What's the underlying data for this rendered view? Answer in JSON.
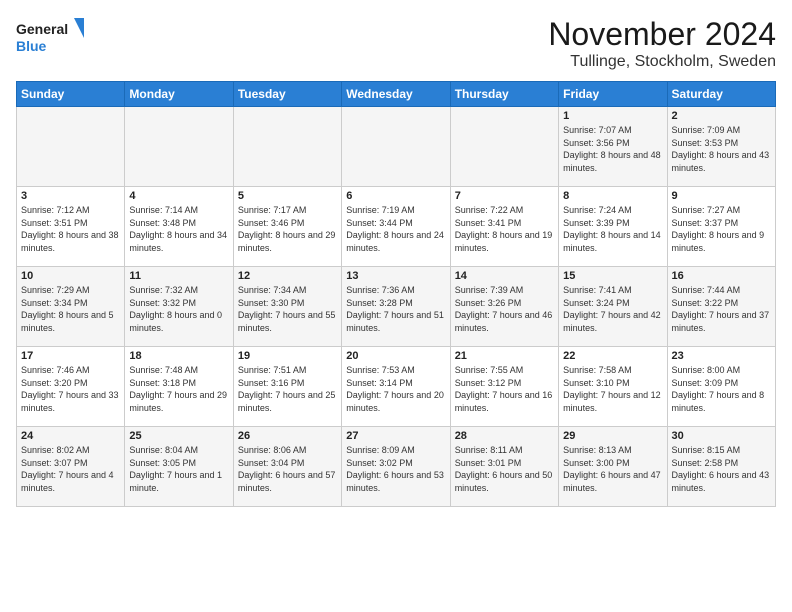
{
  "header": {
    "logo_general": "General",
    "logo_blue": "Blue",
    "month_year": "November 2024",
    "location": "Tullinge, Stockholm, Sweden"
  },
  "weekdays": [
    "Sunday",
    "Monday",
    "Tuesday",
    "Wednesday",
    "Thursday",
    "Friday",
    "Saturday"
  ],
  "weeks": [
    [
      {
        "day": "",
        "info": ""
      },
      {
        "day": "",
        "info": ""
      },
      {
        "day": "",
        "info": ""
      },
      {
        "day": "",
        "info": ""
      },
      {
        "day": "",
        "info": ""
      },
      {
        "day": "1",
        "info": "Sunrise: 7:07 AM\nSunset: 3:56 PM\nDaylight: 8 hours and 48 minutes."
      },
      {
        "day": "2",
        "info": "Sunrise: 7:09 AM\nSunset: 3:53 PM\nDaylight: 8 hours and 43 minutes."
      }
    ],
    [
      {
        "day": "3",
        "info": "Sunrise: 7:12 AM\nSunset: 3:51 PM\nDaylight: 8 hours and 38 minutes."
      },
      {
        "day": "4",
        "info": "Sunrise: 7:14 AM\nSunset: 3:48 PM\nDaylight: 8 hours and 34 minutes."
      },
      {
        "day": "5",
        "info": "Sunrise: 7:17 AM\nSunset: 3:46 PM\nDaylight: 8 hours and 29 minutes."
      },
      {
        "day": "6",
        "info": "Sunrise: 7:19 AM\nSunset: 3:44 PM\nDaylight: 8 hours and 24 minutes."
      },
      {
        "day": "7",
        "info": "Sunrise: 7:22 AM\nSunset: 3:41 PM\nDaylight: 8 hours and 19 minutes."
      },
      {
        "day": "8",
        "info": "Sunrise: 7:24 AM\nSunset: 3:39 PM\nDaylight: 8 hours and 14 minutes."
      },
      {
        "day": "9",
        "info": "Sunrise: 7:27 AM\nSunset: 3:37 PM\nDaylight: 8 hours and 9 minutes."
      }
    ],
    [
      {
        "day": "10",
        "info": "Sunrise: 7:29 AM\nSunset: 3:34 PM\nDaylight: 8 hours and 5 minutes."
      },
      {
        "day": "11",
        "info": "Sunrise: 7:32 AM\nSunset: 3:32 PM\nDaylight: 8 hours and 0 minutes."
      },
      {
        "day": "12",
        "info": "Sunrise: 7:34 AM\nSunset: 3:30 PM\nDaylight: 7 hours and 55 minutes."
      },
      {
        "day": "13",
        "info": "Sunrise: 7:36 AM\nSunset: 3:28 PM\nDaylight: 7 hours and 51 minutes."
      },
      {
        "day": "14",
        "info": "Sunrise: 7:39 AM\nSunset: 3:26 PM\nDaylight: 7 hours and 46 minutes."
      },
      {
        "day": "15",
        "info": "Sunrise: 7:41 AM\nSunset: 3:24 PM\nDaylight: 7 hours and 42 minutes."
      },
      {
        "day": "16",
        "info": "Sunrise: 7:44 AM\nSunset: 3:22 PM\nDaylight: 7 hours and 37 minutes."
      }
    ],
    [
      {
        "day": "17",
        "info": "Sunrise: 7:46 AM\nSunset: 3:20 PM\nDaylight: 7 hours and 33 minutes."
      },
      {
        "day": "18",
        "info": "Sunrise: 7:48 AM\nSunset: 3:18 PM\nDaylight: 7 hours and 29 minutes."
      },
      {
        "day": "19",
        "info": "Sunrise: 7:51 AM\nSunset: 3:16 PM\nDaylight: 7 hours and 25 minutes."
      },
      {
        "day": "20",
        "info": "Sunrise: 7:53 AM\nSunset: 3:14 PM\nDaylight: 7 hours and 20 minutes."
      },
      {
        "day": "21",
        "info": "Sunrise: 7:55 AM\nSunset: 3:12 PM\nDaylight: 7 hours and 16 minutes."
      },
      {
        "day": "22",
        "info": "Sunrise: 7:58 AM\nSunset: 3:10 PM\nDaylight: 7 hours and 12 minutes."
      },
      {
        "day": "23",
        "info": "Sunrise: 8:00 AM\nSunset: 3:09 PM\nDaylight: 7 hours and 8 minutes."
      }
    ],
    [
      {
        "day": "24",
        "info": "Sunrise: 8:02 AM\nSunset: 3:07 PM\nDaylight: 7 hours and 4 minutes."
      },
      {
        "day": "25",
        "info": "Sunrise: 8:04 AM\nSunset: 3:05 PM\nDaylight: 7 hours and 1 minute."
      },
      {
        "day": "26",
        "info": "Sunrise: 8:06 AM\nSunset: 3:04 PM\nDaylight: 6 hours and 57 minutes."
      },
      {
        "day": "27",
        "info": "Sunrise: 8:09 AM\nSunset: 3:02 PM\nDaylight: 6 hours and 53 minutes."
      },
      {
        "day": "28",
        "info": "Sunrise: 8:11 AM\nSunset: 3:01 PM\nDaylight: 6 hours and 50 minutes."
      },
      {
        "day": "29",
        "info": "Sunrise: 8:13 AM\nSunset: 3:00 PM\nDaylight: 6 hours and 47 minutes."
      },
      {
        "day": "30",
        "info": "Sunrise: 8:15 AM\nSunset: 2:58 PM\nDaylight: 6 hours and 43 minutes."
      }
    ]
  ]
}
